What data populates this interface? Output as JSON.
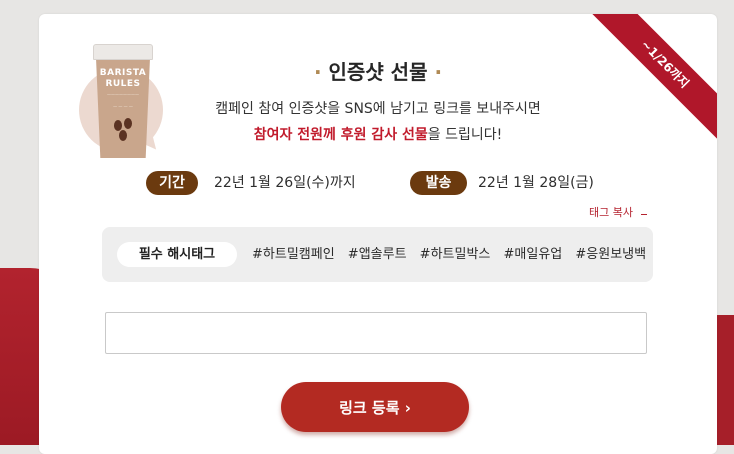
{
  "ribbon": {
    "label": "~1/26까지"
  },
  "product": {
    "brand_line1": "BARISTA",
    "brand_line2": "RULES"
  },
  "header": {
    "title": "인증샷 선물",
    "title_dot_left": "·",
    "title_dot_right": "·",
    "desc_line1": "캠페인 참여 인증샷을 SNS에 남기고 링크를 보내주시면",
    "desc_line2_highlight": "참여자 전원께 후원 감사 선물",
    "desc_line2_rest": "을 드립니다!"
  },
  "period": {
    "label": "기간",
    "value": "22년 1월 26일(수)까지"
  },
  "shipping": {
    "label": "발송",
    "value": "22년 1월 28일(금)"
  },
  "tag_copy": {
    "label": "태그 복사"
  },
  "hashtags": {
    "required_label": "필수 해시태그",
    "tags": [
      "#하트밀캠페인",
      "#앱솔루트",
      "#하트밀박스",
      "#매일유업",
      "#응원보냉백"
    ]
  },
  "link_input": {
    "value": "",
    "placeholder": ""
  },
  "submit": {
    "label": "링크 등록 ›"
  },
  "colors": {
    "accent_red": "#b32a22",
    "highlight_red": "#c11b2c",
    "brown_pill": "#6b3a0f",
    "ribbon_red": "#b0172a"
  }
}
